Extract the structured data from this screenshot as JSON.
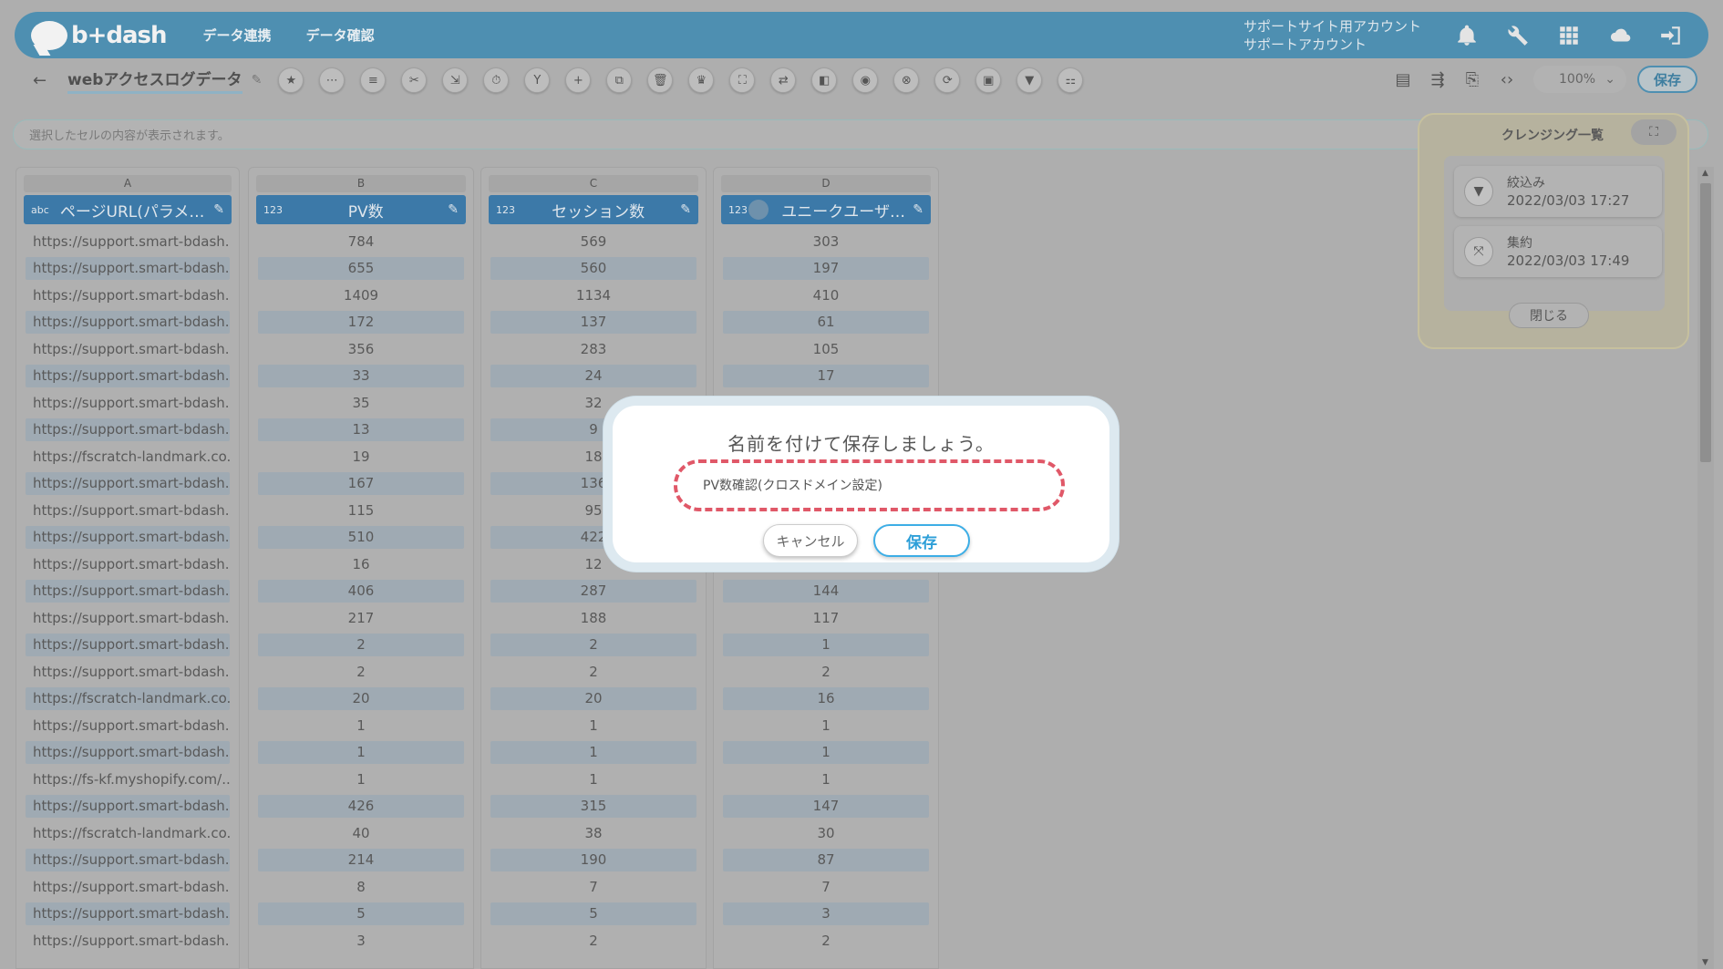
{
  "header": {
    "logo_text": "b+dash",
    "nav": [
      "データ連携",
      "データ確認"
    ],
    "account_line1": "サポートサイト用アカウント",
    "account_line2": "サポートアカウント",
    "icons": [
      "bell-icon",
      "wrench-icon",
      "grid-icon",
      "cloud-icon",
      "logout-icon"
    ]
  },
  "toolbar": {
    "back_icon": "←",
    "sheet_title": "webアクセスログデータ",
    "tools": [
      "★",
      "⋯",
      "≡",
      "✂",
      "⇲",
      "⏱",
      "Y",
      "+",
      "⧉",
      "🗑",
      "♛",
      "⛶",
      "⇄",
      "◧",
      "◉",
      "⊗",
      "⟳",
      "▣",
      "▼",
      "⚏"
    ],
    "zoom": "100%",
    "save_label": "保存"
  },
  "cellbar": {
    "placeholder": "選択したセルの内容が表示されます。"
  },
  "grid": {
    "columns": [
      {
        "letter": "A",
        "type": "abc",
        "label": "ページURL(パラメ…"
      },
      {
        "letter": "B",
        "type": "123",
        "label": "PV数"
      },
      {
        "letter": "C",
        "type": "123",
        "label": "セッション数"
      },
      {
        "letter": "D",
        "type": "123",
        "label": "ユニークユーザ…"
      }
    ],
    "colA": [
      "https://support.smart-bdash...",
      "https://support.smart-bdash...",
      "https://support.smart-bdash...",
      "https://support.smart-bdash...",
      "https://support.smart-bdash...",
      "https://support.smart-bdash...",
      "https://support.smart-bdash...",
      "https://support.smart-bdash...",
      "https://fscratch-landmark.co...",
      "https://support.smart-bdash...",
      "https://support.smart-bdash...",
      "https://support.smart-bdash...",
      "https://support.smart-bdash...",
      "https://support.smart-bdash...",
      "https://support.smart-bdash...",
      "https://support.smart-bdash...",
      "https://support.smart-bdash...",
      "https://fscratch-landmark.co...",
      "https://support.smart-bdash...",
      "https://support.smart-bdash...",
      "https://fs-kf.myshopify.com/...",
      "https://support.smart-bdash...",
      "https://fscratch-landmark.co...",
      "https://support.smart-bdash...",
      "https://support.smart-bdash...",
      "https://support.smart-bdash...",
      "https://support.smart-bdash..."
    ],
    "colB": [
      "784",
      "655",
      "1409",
      "172",
      "356",
      "33",
      "35",
      "13",
      "19",
      "167",
      "115",
      "510",
      "16",
      "406",
      "217",
      "2",
      "2",
      "20",
      "1",
      "1",
      "1",
      "426",
      "40",
      "214",
      "8",
      "5",
      "3"
    ],
    "colC": [
      "569",
      "560",
      "1134",
      "137",
      "283",
      "24",
      "32",
      "9",
      "18",
      "136",
      "95",
      "422",
      "12",
      "287",
      "188",
      "2",
      "2",
      "20",
      "1",
      "1",
      "1",
      "315",
      "38",
      "190",
      "7",
      "5",
      "2"
    ],
    "colD": [
      "303",
      "197",
      "410",
      "61",
      "105",
      "17",
      "",
      "",
      "",
      "",
      "",
      "",
      "",
      "144",
      "117",
      "1",
      "2",
      "16",
      "1",
      "1",
      "1",
      "147",
      "30",
      "87",
      "7",
      "3",
      "2"
    ]
  },
  "cleansing": {
    "title": "クレンジング一覧",
    "items": [
      {
        "name": "絞込み",
        "date": "2022/03/03 17:27",
        "icon": "filter-icon"
      },
      {
        "name": "集約",
        "date": "2022/03/03 17:49",
        "icon": "collapse-icon"
      }
    ],
    "close_label": "閉じる"
  },
  "modal": {
    "title": "名前を付けて保存しましょう。",
    "input_value": "PV数確認(クロスドメイン設定)",
    "cancel_label": "キャンセル",
    "save_label": "保存",
    "highlight_color": "#e05868"
  }
}
